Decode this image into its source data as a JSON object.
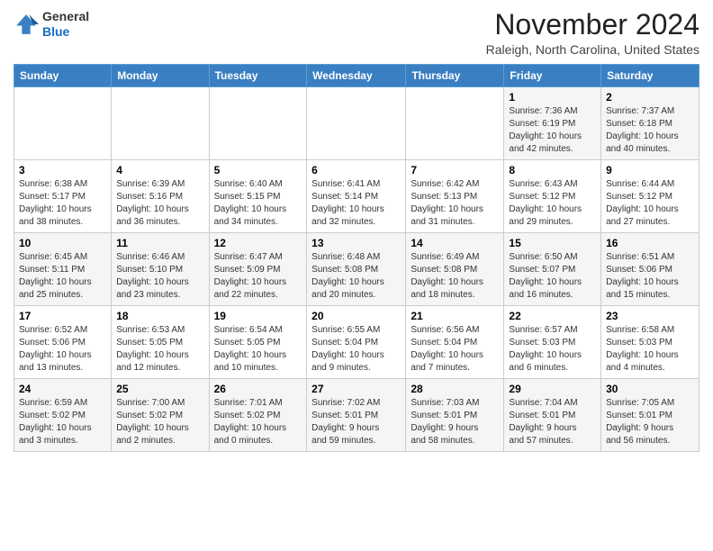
{
  "logo": {
    "general": "General",
    "blue": "Blue"
  },
  "header": {
    "month_title": "November 2024",
    "subtitle": "Raleigh, North Carolina, United States"
  },
  "weekdays": [
    "Sunday",
    "Monday",
    "Tuesday",
    "Wednesday",
    "Thursday",
    "Friday",
    "Saturday"
  ],
  "rows": [
    [
      {
        "day": "",
        "info": ""
      },
      {
        "day": "",
        "info": ""
      },
      {
        "day": "",
        "info": ""
      },
      {
        "day": "",
        "info": ""
      },
      {
        "day": "",
        "info": ""
      },
      {
        "day": "1",
        "info": "Sunrise: 7:36 AM\nSunset: 6:19 PM\nDaylight: 10 hours\nand 42 minutes."
      },
      {
        "day": "2",
        "info": "Sunrise: 7:37 AM\nSunset: 6:18 PM\nDaylight: 10 hours\nand 40 minutes."
      }
    ],
    [
      {
        "day": "3",
        "info": "Sunrise: 6:38 AM\nSunset: 5:17 PM\nDaylight: 10 hours\nand 38 minutes."
      },
      {
        "day": "4",
        "info": "Sunrise: 6:39 AM\nSunset: 5:16 PM\nDaylight: 10 hours\nand 36 minutes."
      },
      {
        "day": "5",
        "info": "Sunrise: 6:40 AM\nSunset: 5:15 PM\nDaylight: 10 hours\nand 34 minutes."
      },
      {
        "day": "6",
        "info": "Sunrise: 6:41 AM\nSunset: 5:14 PM\nDaylight: 10 hours\nand 32 minutes."
      },
      {
        "day": "7",
        "info": "Sunrise: 6:42 AM\nSunset: 5:13 PM\nDaylight: 10 hours\nand 31 minutes."
      },
      {
        "day": "8",
        "info": "Sunrise: 6:43 AM\nSunset: 5:12 PM\nDaylight: 10 hours\nand 29 minutes."
      },
      {
        "day": "9",
        "info": "Sunrise: 6:44 AM\nSunset: 5:12 PM\nDaylight: 10 hours\nand 27 minutes."
      }
    ],
    [
      {
        "day": "10",
        "info": "Sunrise: 6:45 AM\nSunset: 5:11 PM\nDaylight: 10 hours\nand 25 minutes."
      },
      {
        "day": "11",
        "info": "Sunrise: 6:46 AM\nSunset: 5:10 PM\nDaylight: 10 hours\nand 23 minutes."
      },
      {
        "day": "12",
        "info": "Sunrise: 6:47 AM\nSunset: 5:09 PM\nDaylight: 10 hours\nand 22 minutes."
      },
      {
        "day": "13",
        "info": "Sunrise: 6:48 AM\nSunset: 5:08 PM\nDaylight: 10 hours\nand 20 minutes."
      },
      {
        "day": "14",
        "info": "Sunrise: 6:49 AM\nSunset: 5:08 PM\nDaylight: 10 hours\nand 18 minutes."
      },
      {
        "day": "15",
        "info": "Sunrise: 6:50 AM\nSunset: 5:07 PM\nDaylight: 10 hours\nand 16 minutes."
      },
      {
        "day": "16",
        "info": "Sunrise: 6:51 AM\nSunset: 5:06 PM\nDaylight: 10 hours\nand 15 minutes."
      }
    ],
    [
      {
        "day": "17",
        "info": "Sunrise: 6:52 AM\nSunset: 5:06 PM\nDaylight: 10 hours\nand 13 minutes."
      },
      {
        "day": "18",
        "info": "Sunrise: 6:53 AM\nSunset: 5:05 PM\nDaylight: 10 hours\nand 12 minutes."
      },
      {
        "day": "19",
        "info": "Sunrise: 6:54 AM\nSunset: 5:05 PM\nDaylight: 10 hours\nand 10 minutes."
      },
      {
        "day": "20",
        "info": "Sunrise: 6:55 AM\nSunset: 5:04 PM\nDaylight: 10 hours\nand 9 minutes."
      },
      {
        "day": "21",
        "info": "Sunrise: 6:56 AM\nSunset: 5:04 PM\nDaylight: 10 hours\nand 7 minutes."
      },
      {
        "day": "22",
        "info": "Sunrise: 6:57 AM\nSunset: 5:03 PM\nDaylight: 10 hours\nand 6 minutes."
      },
      {
        "day": "23",
        "info": "Sunrise: 6:58 AM\nSunset: 5:03 PM\nDaylight: 10 hours\nand 4 minutes."
      }
    ],
    [
      {
        "day": "24",
        "info": "Sunrise: 6:59 AM\nSunset: 5:02 PM\nDaylight: 10 hours\nand 3 minutes."
      },
      {
        "day": "25",
        "info": "Sunrise: 7:00 AM\nSunset: 5:02 PM\nDaylight: 10 hours\nand 2 minutes."
      },
      {
        "day": "26",
        "info": "Sunrise: 7:01 AM\nSunset: 5:02 PM\nDaylight: 10 hours\nand 0 minutes."
      },
      {
        "day": "27",
        "info": "Sunrise: 7:02 AM\nSunset: 5:01 PM\nDaylight: 9 hours\nand 59 minutes."
      },
      {
        "day": "28",
        "info": "Sunrise: 7:03 AM\nSunset: 5:01 PM\nDaylight: 9 hours\nand 58 minutes."
      },
      {
        "day": "29",
        "info": "Sunrise: 7:04 AM\nSunset: 5:01 PM\nDaylight: 9 hours\nand 57 minutes."
      },
      {
        "day": "30",
        "info": "Sunrise: 7:05 AM\nSunset: 5:01 PM\nDaylight: 9 hours\nand 56 minutes."
      }
    ]
  ]
}
